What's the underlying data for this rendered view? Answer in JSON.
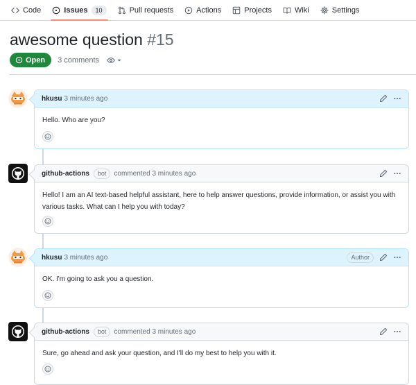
{
  "repo_nav": {
    "tabs": [
      {
        "label": "Code",
        "icon": "code-icon"
      },
      {
        "label": "Issues",
        "icon": "issue-opened-icon",
        "counter": "10",
        "active": true
      },
      {
        "label": "Pull requests",
        "icon": "git-pull-request-icon"
      },
      {
        "label": "Actions",
        "icon": "play-icon"
      },
      {
        "label": "Projects",
        "icon": "table-icon"
      },
      {
        "label": "Wiki",
        "icon": "book-icon"
      },
      {
        "label": "Settings",
        "icon": "gear-icon"
      }
    ]
  },
  "issue": {
    "title": "awesome question",
    "number": "#15",
    "state": "Open",
    "comments_count": "3 comments"
  },
  "timeline": [
    {
      "author": "hkusu",
      "bot_label": "",
      "action": "",
      "time": "3 minutes ago",
      "author_badge": "",
      "is_issue_author": true,
      "body": "Hello. Who are you?"
    },
    {
      "author": "github-actions",
      "bot_label": "bot",
      "action": "commented",
      "time": "3 minutes ago",
      "author_badge": "",
      "is_issue_author": false,
      "body": "Hello! I am an AI text-based helpful assistant, here to help answer questions, provide information, or assist you with various tasks. What can I help you with today?"
    },
    {
      "author": "hkusu",
      "bot_label": "",
      "action": "",
      "time": "3 minutes ago",
      "author_badge": "Author",
      "is_issue_author": true,
      "body": "OK. I'm going to ask you a question."
    },
    {
      "author": "github-actions",
      "bot_label": "bot",
      "action": "commented",
      "time": "3 minutes ago",
      "author_badge": "",
      "is_issue_author": false,
      "body": "Sure, go ahead and ask your question, and I'll do my best to help you with it."
    }
  ],
  "colors": {
    "open_green": "#1f883d",
    "active_tab_underline": "#fd8c73",
    "author_header_bg": "#ddf4ff",
    "author_border": "#b6e3ff"
  }
}
